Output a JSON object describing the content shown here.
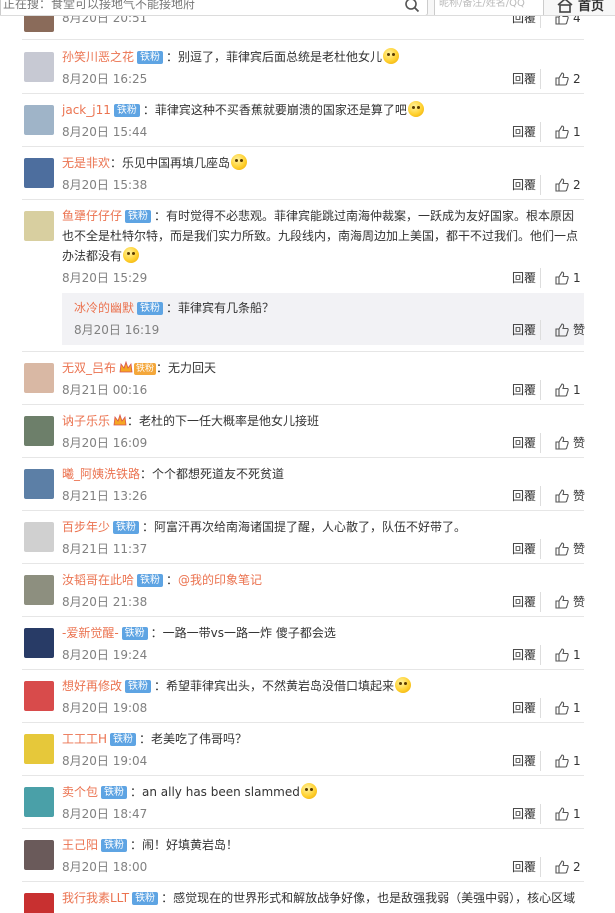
{
  "topbar": {
    "search_placeholder": "正在搜：食堂可以接地气不能接地府",
    "user_placeholder": "昵称/备注/姓名/QQ",
    "home_label": "首页"
  },
  "comments": [
    {
      "user": "孙笑川恶之花",
      "badge": "铁粉",
      "text": "：别逗了，菲律宾后面总统是老杜他女儿",
      "emoji": true,
      "time": "8月20日 16:25",
      "reply": "回覆",
      "likes": "2"
    },
    {
      "user": "jack_j11",
      "badge": "铁粉",
      "text": "：菲律宾这种不买香蕉就要崩溃的国家还是算了吧",
      "emoji": true,
      "time": "8月20日 15:44",
      "reply": "回覆",
      "likes": "1"
    },
    {
      "user": "无是非欢",
      "badge": "",
      "text": "：乐见中国再填几座岛",
      "emoji": true,
      "time": "8月20日 15:38",
      "reply": "回覆",
      "likes": "2"
    },
    {
      "user": "鱼犟仔仔仔",
      "badge": "铁粉",
      "text": "：有时觉得不必悲观。菲律宾能跳过南海仲裁案，一跃成为友好国家。根本原因也不全是杜特尔特，而是我们实力所致。九段线内，南海周边加上美国，都干不过我们。他们一点办法都没有",
      "emoji": true,
      "time": "8月20日 15:29",
      "reply": "回覆",
      "likes": "1",
      "sub": {
        "user": "冰冷的幽默",
        "badge": "铁粉",
        "text": "：菲律宾有几条船？",
        "time": "8月20日 16:19",
        "reply": "回覆",
        "likes": "赞"
      }
    },
    {
      "user": "无双_吕布",
      "badge": "",
      "vip": "铁粉",
      "crown": true,
      "text": "：无力回天",
      "emoji": false,
      "time": "8月21日 00:16",
      "reply": "回覆",
      "likes": "1"
    },
    {
      "user": "讷子乐乐",
      "badge": "",
      "crown": true,
      "text": "：老杜的下一任大概率是他女儿接班",
      "emoji": false,
      "time": "8月20日 16:09",
      "reply": "回覆",
      "likes": "赞"
    },
    {
      "user": "曦_阿姨洗铁路",
      "badge": "",
      "text": "：个个都想死道友不死贫道",
      "emoji": false,
      "time": "8月21日 13:26",
      "reply": "回覆",
      "likes": "赞"
    },
    {
      "user": "百步年少",
      "badge": "铁粉",
      "text": "：阿富汗再次给南海诸国提了醒，人心散了，队伍不好带了。",
      "emoji": false,
      "time": "8月21日 11:37",
      "reply": "回覆",
      "likes": "赞"
    },
    {
      "user": "汝韬哥在此哈",
      "badge": "铁粉",
      "text": "：",
      "mention": "@我的印象笔记",
      "emoji": false,
      "time": "8月20日 21:38",
      "reply": "回覆",
      "likes": "赞"
    },
    {
      "user": "-爱新觉醒-",
      "badge": "铁粉",
      "text": "：一路一带vs一路一炸 傻子都会选",
      "emoji": false,
      "time": "8月20日 19:24",
      "reply": "回覆",
      "likes": "1"
    },
    {
      "user": "想好再修改",
      "badge": "铁粉",
      "text": "：希望菲律宾出头，不然黄岩岛没借口填起来",
      "emoji": true,
      "time": "8月20日 19:08",
      "reply": "回覆",
      "likes": "1"
    },
    {
      "user": "工工工H",
      "badge": "铁粉",
      "text": "：老美吃了伟哥吗？",
      "emoji": false,
      "time": "8月20日 19:04",
      "reply": "回覆",
      "likes": "1"
    },
    {
      "user": "卖个包",
      "badge": "铁粉",
      "text": "：an ally has been slammed",
      "emoji": true,
      "time": "8月20日 18:47",
      "reply": "回覆",
      "likes": "1"
    },
    {
      "user": "王己阳",
      "badge": "铁粉",
      "text": "：闹！好填黄岩岛！",
      "emoji": false,
      "time": "8月20日 18:00",
      "reply": "回覆",
      "likes": "2"
    },
    {
      "user": "我行我素LLT",
      "badge": "铁粉",
      "text": "：感觉现在的世界形式和解放战争好像，也是敌强我弱（美强中弱），核心区域",
      "emoji": false,
      "time": "",
      "reply": "",
      "likes": ""
    }
  ],
  "partial_top": {
    "time": "8月20日 20:51",
    "reply": "回覆",
    "likes": "4"
  },
  "colors": {
    "username": "#eb7350",
    "badge": "#5ea4e3",
    "meta": "#808080"
  }
}
